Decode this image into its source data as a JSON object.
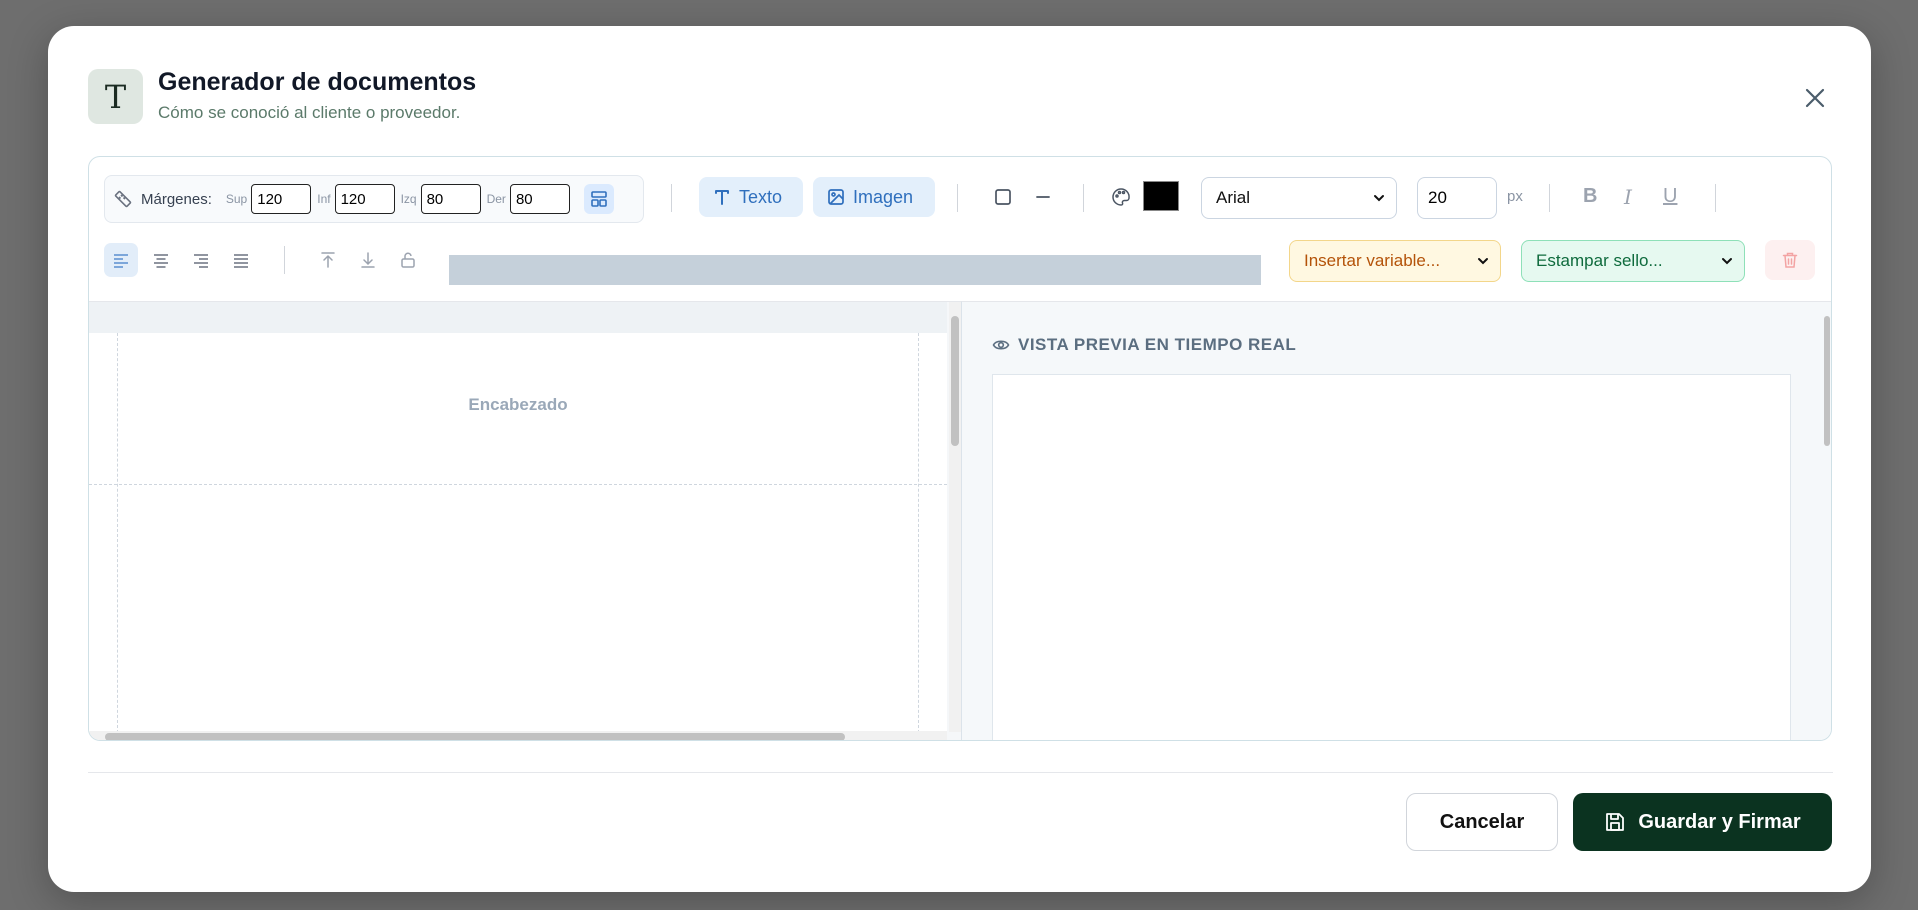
{
  "dialog": {
    "icon_glyph": "T",
    "title": "Generador de documentos",
    "subtitle": "Cómo se conoció al cliente o proveedor."
  },
  "toolbar": {
    "margins_label": "Márgenes:",
    "margins": [
      {
        "label": "Sup",
        "value": "120"
      },
      {
        "label": "Inf",
        "value": "120"
      },
      {
        "label": "Izq",
        "value": "80"
      },
      {
        "label": "Der",
        "value": "80"
      }
    ],
    "text_button": "Texto",
    "image_button": "Imagen",
    "color_value": "#000000",
    "font_family": "Arial",
    "font_size": "20",
    "font_unit": "px",
    "bold": "B",
    "italic": "I",
    "underline": "U",
    "insert_variable": "Insertar variable...",
    "stamp_seal": "Estampar sello..."
  },
  "editor": {
    "header_label": "Encabezado"
  },
  "preview": {
    "title": "VISTA PREVIA EN TIEMPO REAL"
  },
  "footer": {
    "cancel": "Cancelar",
    "save": "Guardar y Firmar"
  },
  "colors": {
    "accent_blue": "#2f6fbd",
    "primary_dark_green": "#0b3320",
    "variable_orange": "#b45309",
    "stamp_green": "#0f6b3d"
  }
}
